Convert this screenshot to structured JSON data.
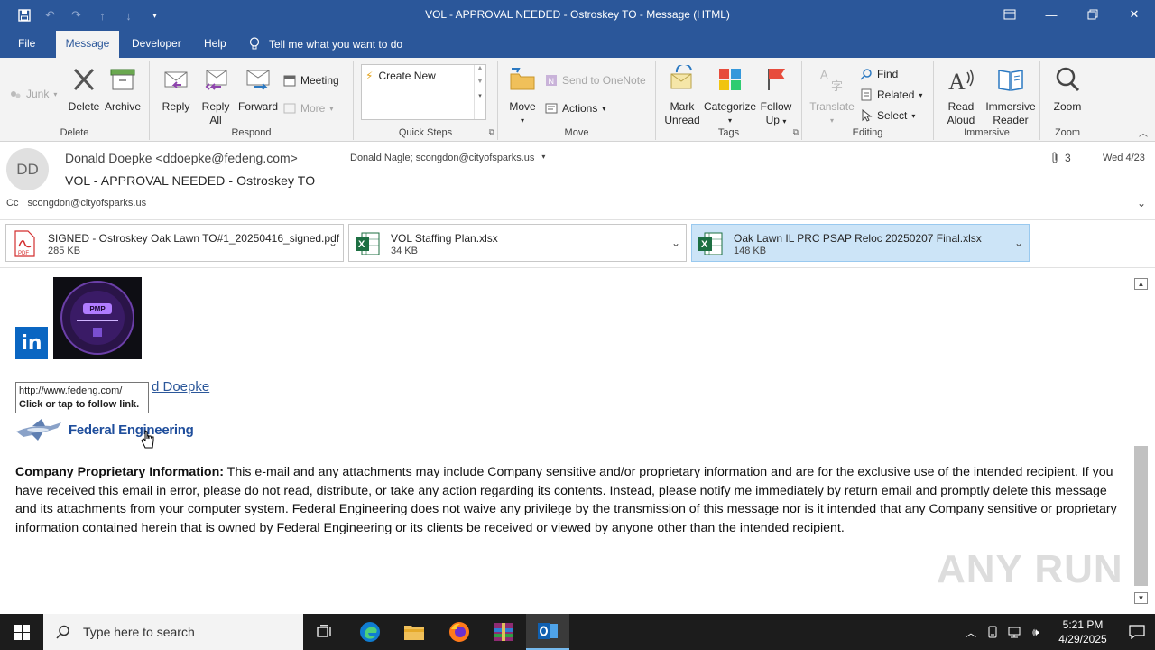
{
  "window": {
    "title": "VOL - APPROVAL NEEDED - Ostroskey TO  -  Message (HTML)"
  },
  "menu": {
    "tabs": [
      "File",
      "Message",
      "Developer",
      "Help"
    ],
    "tell_me": "Tell me what you want to do"
  },
  "ribbon": {
    "delete_group": {
      "label": "Delete",
      "junk": "Junk",
      "delete": "Delete",
      "archive": "Archive"
    },
    "respond_group": {
      "label": "Respond",
      "reply": "Reply",
      "reply_all_1": "Reply",
      "reply_all_2": "All",
      "forward": "Forward",
      "meeting": "Meeting",
      "more": "More"
    },
    "quicksteps_group": {
      "label": "Quick Steps",
      "create_new": "Create New"
    },
    "move_group": {
      "label": "Move",
      "move": "Move",
      "onenote": "Send to OneNote",
      "actions": "Actions"
    },
    "tags_group": {
      "label": "Tags",
      "mark_unread_1": "Mark",
      "mark_unread_2": "Unread",
      "categorize": "Categorize",
      "follow_up_1": "Follow",
      "follow_up_2": "Up"
    },
    "editing_group": {
      "label": "Editing",
      "translate": "Translate",
      "find": "Find",
      "related": "Related",
      "select": "Select"
    },
    "immersive_group": {
      "label": "Immersive",
      "read_aloud_1": "Read",
      "read_aloud_2": "Aloud",
      "immersive_reader_1": "Immersive",
      "immersive_reader_2": "Reader"
    },
    "zoom_group": {
      "label": "Zoom",
      "zoom": "Zoom"
    }
  },
  "message": {
    "avatar_initials": "DD",
    "from": "Donald Doepke <ddoepke@fedeng.com>",
    "subject": "VOL - APPROVAL NEEDED - Ostroskey TO",
    "to": "Donald Nagle; scongdon@cityofsparks.us",
    "attachment_count": "3",
    "date": "Wed 4/23",
    "cc_label": "Cc",
    "cc": "scongdon@cityofsparks.us"
  },
  "attachments": [
    {
      "name": "SIGNED - Ostroskey Oak Lawn TO#1_20250416_signed.pdf",
      "size": "285 KB",
      "type": "pdf"
    },
    {
      "name": "VOL Staffing Plan.xlsx",
      "size": "34 KB",
      "type": "xlsx"
    },
    {
      "name": "Oak Lawn IL PRC PSAP Reloc 20250207 Final.xlsx",
      "size": "148 KB",
      "type": "xlsx"
    }
  ],
  "body": {
    "linkedin": "in",
    "pmp_badge": "PMP",
    "signature_link": "d Doepke",
    "tooltip_url": "http://www.fedeng.com/",
    "tooltip_hint": "Click or tap to follow link.",
    "company_logo_text": "Federal Engineering",
    "disclaimer_heading": "Company Proprietary Information:",
    "disclaimer_text": " This e-mail and any attachments may include Company sensitive and/or proprietary information and are for the exclusive use of the intended recipient. If you have received this email in error, please do not read, distribute, or take any action regarding its contents. Instead, please notify me immediately by return email and promptly delete this message and its attachments from your computer system. Federal Engineering does not waive any privilege by the transmission of this message nor is it intended that any Company sensitive or proprietary information contained herein that is owned by Federal Engineering or its clients be received or viewed by anyone other than the intended recipient."
  },
  "watermark": "ANY RUN",
  "taskbar": {
    "search_placeholder": "Type here to search",
    "time": "5:21 PM",
    "date": "4/29/2025"
  },
  "colors": {
    "accent": "#2b579a",
    "taskbar": "#1c1c1c",
    "selected_attachment": "#cce4f7"
  }
}
